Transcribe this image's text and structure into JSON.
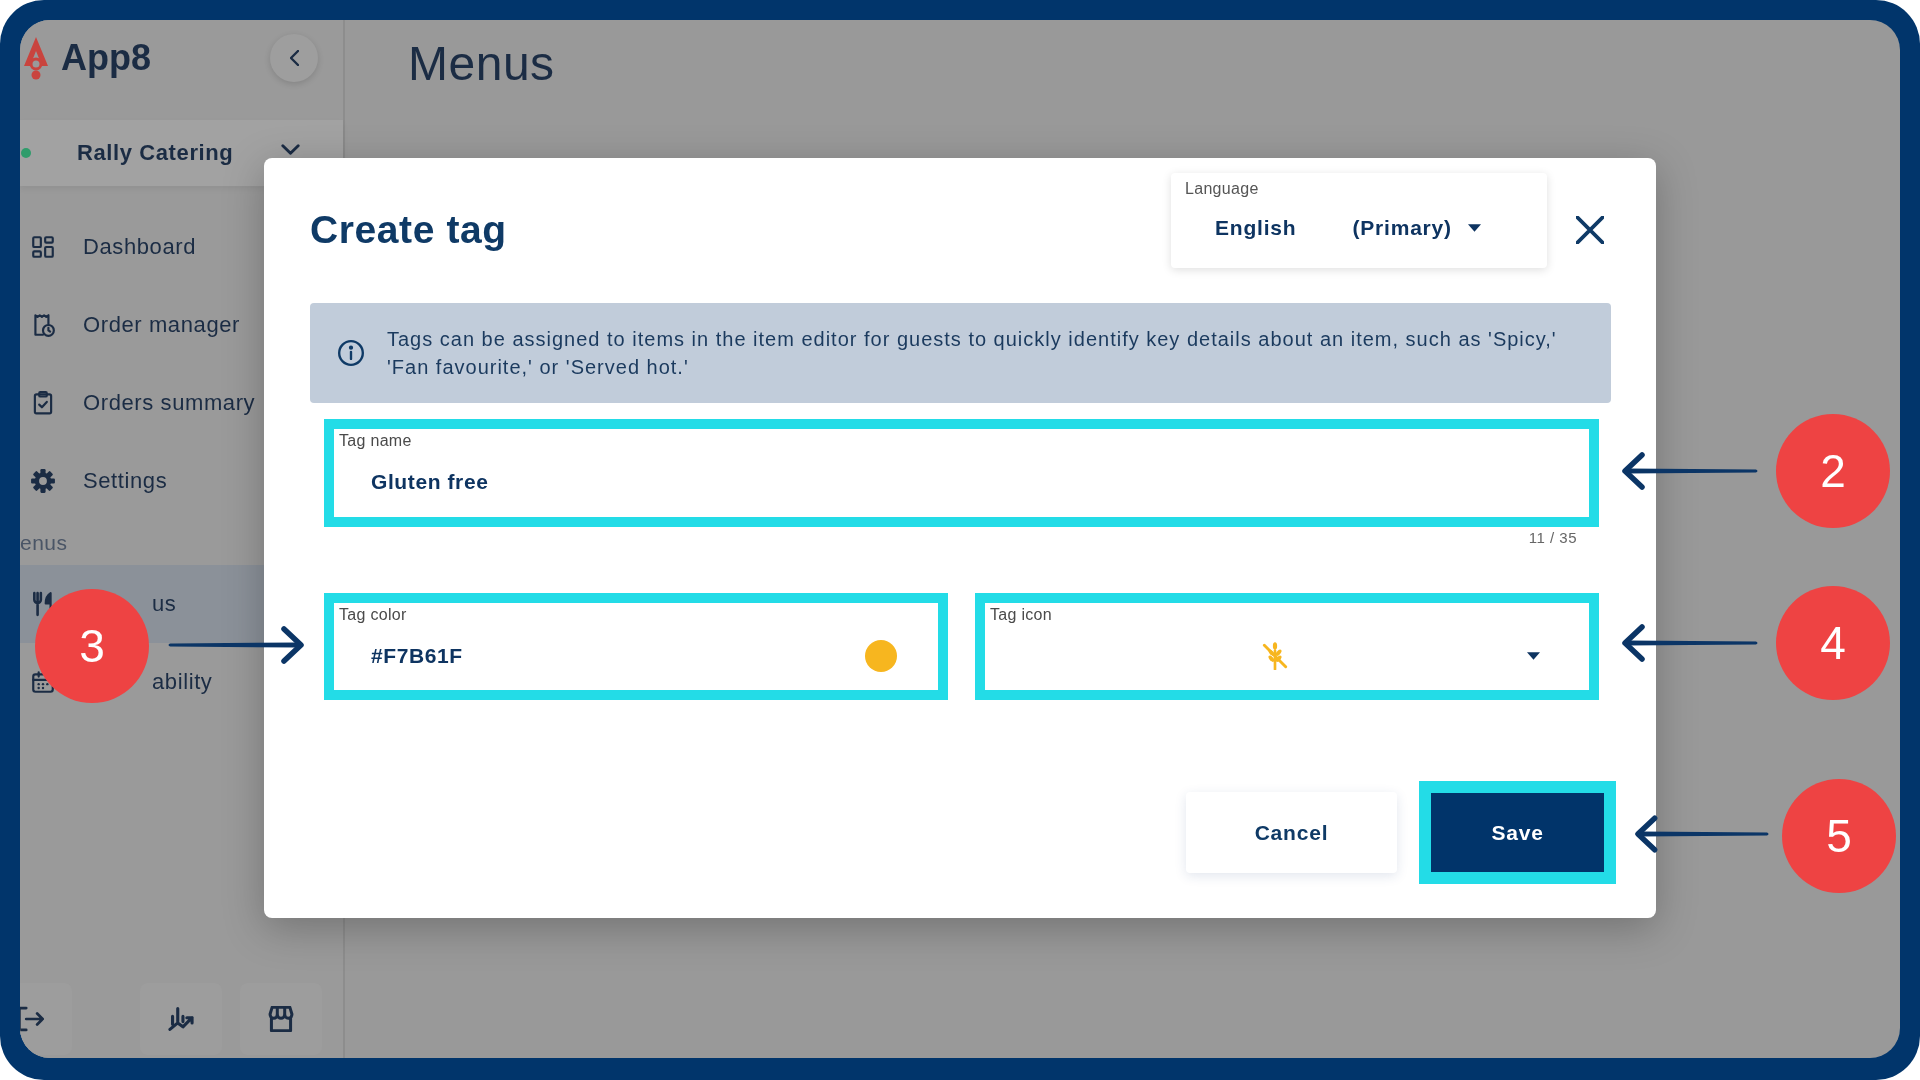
{
  "sidebar": {
    "logo": "App8",
    "venue": {
      "name": "Rally Catering",
      "active": true
    },
    "nav": [
      {
        "label": "Dashboard",
        "selected": false
      },
      {
        "label": "Order manager",
        "selected": false
      },
      {
        "label": "Orders summary",
        "selected": false
      },
      {
        "label": "Settings",
        "selected": false
      }
    ],
    "section": {
      "title": "enus",
      "items": [
        {
          "label": "us",
          "selected": true
        },
        {
          "label": "ability",
          "selected": false
        }
      ]
    }
  },
  "page": {
    "title": "Menus"
  },
  "dialog": {
    "title": "Create tag",
    "language": {
      "label": "Language",
      "value": "English",
      "note": "(Primary)"
    },
    "info": "Tags can be assigned to items in the item editor for guests to quickly identify key details about an item, such as 'Spicy,' 'Fan favourite,' or 'Served hot.'",
    "fields": [
      {
        "kind": "text",
        "label": "Tag name",
        "value": "Gluten free",
        "counter": "11 / 35",
        "highlighted": true
      },
      {
        "kind": "color",
        "label": "Tag color",
        "value": "#F7B61F",
        "color": "#f7b61f",
        "highlighted": true
      },
      {
        "kind": "icon",
        "label": "Tag icon",
        "color": "#f7b61f",
        "highlighted": true
      }
    ],
    "buttons": [
      {
        "kind": "secondary",
        "label": "Cancel",
        "highlighted": false
      },
      {
        "kind": "primary",
        "label": "Save",
        "highlighted": true
      }
    ]
  },
  "callouts": [
    {
      "number": "2",
      "kind": "left"
    },
    {
      "number": "3",
      "kind": "right"
    },
    {
      "number": "4",
      "kind": "left"
    },
    {
      "number": "5",
      "kind": "left"
    }
  ]
}
